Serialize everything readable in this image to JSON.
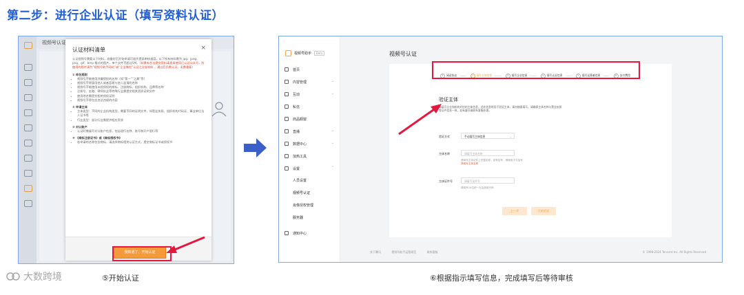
{
  "heading": "第二步：进行企业认证（填写资料认证）",
  "colors": {
    "heading": "#1f5fd6",
    "highlight": "#e5173f",
    "accent": "#f2a640",
    "arrow": "#3a5fc8"
  },
  "left_shot": {
    "bg_title": "视频号认证",
    "modal_title": "认证材料清单",
    "modal_close": "×",
    "intro": "认证视频号需要以下材料，准备好后开始申请可极大提高审核速度。以下所有材料需为 jpg、jpeg、png、gif、bmp 格式的图片，单个文件不超过5M。",
    "intro_red": "（如果有合法提交资料请直接使用已认证公众号，所使用的图片请为“视频号助手网站”或“企业微信”认证之全部材料 ，通过后仍需认证，无需重复）",
    "sections": [
      {
        "title": "① 命名规则",
        "items": [
          "视频号不能使用涉嫌侵权的名称（如“第一”“之最”等）",
          "视频号不得冒用他人或者容易与他人混淆的名称",
          "视频号不能使用未经授权的商标、注册商标、组织机构、品牌等名称",
          "注册号、金融、律师执业等特殊行业需提交相关资质证明文件",
          "使用地名需提交相关授权证明",
          "视频号不得包含违法违规的内容"
        ]
      },
      {
        "title": "② 申请主体",
        "items": [
          "主体类型：不同的企业机构类型，需要不同的证明文件，如营业执照、组织机构代码证、事业单位法人证书等",
          "行业类型：部分行业需提供相应资质"
        ]
      },
      {
        "title": "③ 对公账户",
        "items": [
          "认证时需填写对公账户信息，包括银行名称、账号和开户银行等"
        ]
      },
      {
        "title": "④ 《商标注册证书》或《商标授权书》",
        "items": [
          "若申请的名称包含商标，请选择商标相关认证方式，提交商标证书或授权书"
        ]
      }
    ],
    "start_button": "我知道了，开始认证",
    "caption": "⑤开始认证"
  },
  "right_shot": {
    "logo_text": "视频号助手",
    "logo_badge": "Beta",
    "nav": [
      {
        "label": "首页",
        "icon": "home-icon"
      },
      {
        "label": "内容管理",
        "icon": "content-icon",
        "chev": "⌄"
      },
      {
        "label": "互动",
        "icon": "chat-icon",
        "chev": "⌄"
      },
      {
        "label": "私信",
        "icon": "message-icon"
      },
      {
        "label": "商品橱窗",
        "icon": "shop-icon"
      },
      {
        "label": "直播",
        "icon": "live-icon",
        "chev": "⌄"
      },
      {
        "label": "数据中心",
        "icon": "data-icon",
        "chev": "⌄"
      },
      {
        "label": "加热工具",
        "icon": "boost-icon"
      },
      {
        "label": "设置",
        "icon": "settings-icon",
        "chev": "⌃"
      }
    ],
    "subnav": [
      "人员设置",
      "视频号认证",
      "肖像授权管理",
      "服务器"
    ],
    "nav_bottom": "通知中心",
    "page_title": "视频号认证",
    "steps": [
      {
        "num": "1",
        "label": "阅读协议"
      },
      {
        "num": "2",
        "label": "填写主体信息"
      },
      {
        "num": "3",
        "label": "填写企业信息"
      },
      {
        "num": "4",
        "label": "填写认证信息"
      },
      {
        "num": "5",
        "label": "填写运营者信息"
      },
      {
        "num": "6",
        "label": "支付费用"
      }
    ],
    "form_title": "验证主体",
    "form_desc": "请填写企业和机构对应的主体信息，此处信息将用于验证主体，请勿随意填写。请确保主体名称与营业执照等证件信息一致，若有疑问请联系客服处理。",
    "rows": [
      {
        "label": "验证方式",
        "value": "手动填写主体信息",
        "caret": "⌄"
      },
      {
        "label": "主体名称",
        "placeholder": "请填写主体名称",
        "help": "请填写主体证件上完整名称，如有括号，请使用中文括号",
        "error": "请填写主体名称"
      },
      {
        "label": "主体证件号",
        "placeholder": "请填写证件号",
        "help": "请填写18位统一社会信用代码"
      }
    ],
    "btn_prev": "上一步",
    "btn_submit": "开始验证",
    "footer_links": [
      "关于腾讯",
      "视频号助手运营规范",
      "联系客服"
    ],
    "copyright": "© 1998-2024 Tencent Inc. All Rights Reserved",
    "caption": "⑥根据指示填写信息，完成填写后等待审核"
  },
  "watermark": "大数跨境"
}
